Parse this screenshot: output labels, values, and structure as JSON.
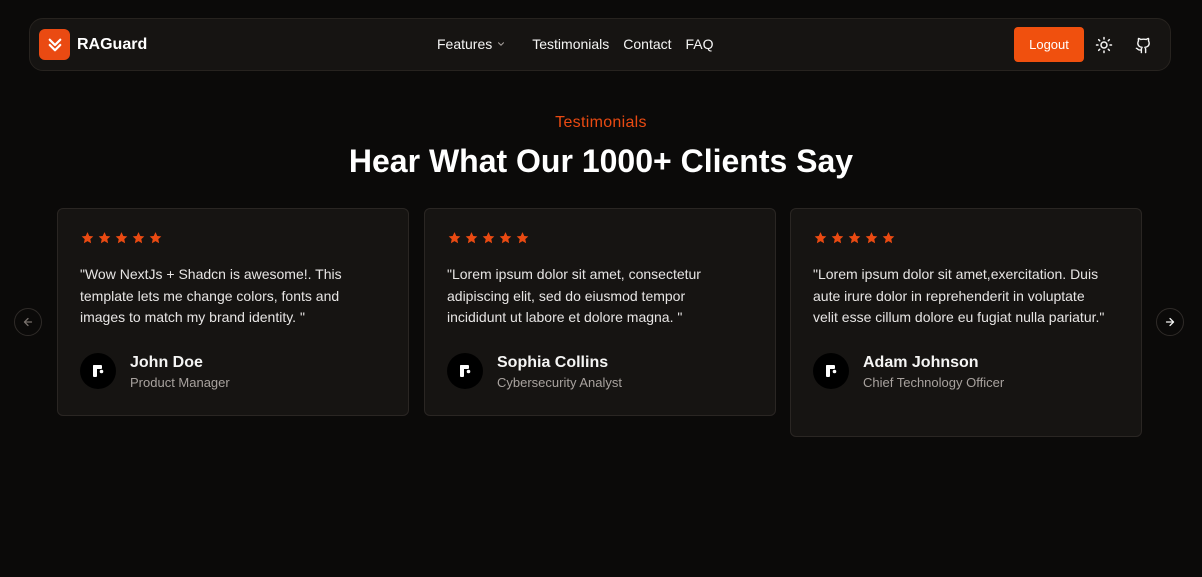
{
  "brand": {
    "name": "RAGuard",
    "accent": "#ea4a12",
    "logo_icon": "double-chevron-down-icon"
  },
  "nav": {
    "features": "Features",
    "testimonials": "Testimonials",
    "contact": "Contact",
    "faq": "FAQ"
  },
  "actions": {
    "logout": "Logout",
    "theme_icon": "sun-icon",
    "github_icon": "github-icon"
  },
  "section": {
    "eyebrow": "Testimonials",
    "heading": "Hear What Our 1000+ Clients Say"
  },
  "testimonials": [
    {
      "rating": 5,
      "quote": "\"Wow NextJs + Shadcn is awesome!. This template lets me change colors, fonts and images to match my brand identity. \"",
      "name": "John Doe",
      "role": "Product Manager"
    },
    {
      "rating": 5,
      "quote": "\"Lorem ipsum dolor sit amet, consectetur adipiscing elit, sed do eiusmod tempor incididunt ut labore et dolore magna. \"",
      "name": "Sophia Collins",
      "role": "Cybersecurity Analyst"
    },
    {
      "rating": 5,
      "quote": "\"Lorem ipsum dolor sit amet,exercitation. Duis aute irure dolor in reprehenderit in voluptate velit esse cillum dolore eu fugiat nulla pariatur.\"",
      "name": "Adam Johnson",
      "role": "Chief Technology Officer"
    }
  ],
  "carousel": {
    "prev_icon": "arrow-left-icon",
    "next_icon": "arrow-right-icon"
  },
  "colors": {
    "background": "#0b0a09",
    "card": "#161412",
    "star": "#ea4a12",
    "button": "#f0500e"
  }
}
